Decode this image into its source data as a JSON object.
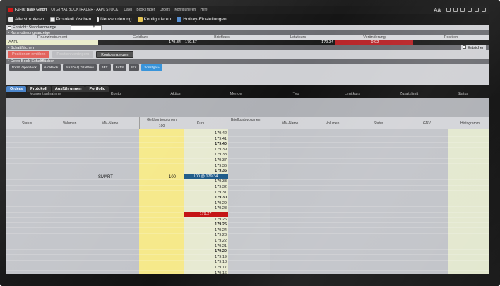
{
  "app": {
    "name": "FXFlat Bank GmbH",
    "window_title": "UTGTHA1 BOOKTRADER - AAPL STOCK",
    "menu": [
      "Datei",
      "BookTrader",
      "Orders",
      "Konfigurieren",
      "Hilfe"
    ],
    "font_label": "Aa"
  },
  "toolbar": {
    "cancel_all": "Alle stornieren",
    "clear_log": "Protokoll löschen",
    "recenter": "Neuzentrierung",
    "configure": "Konfigurieren",
    "hotkey": "Hotkey-Einstellungen"
  },
  "entsicht": {
    "label": "Entsicht: Standardmenge",
    "qty": "5"
  },
  "kurs": {
    "section": "Kursnotierungsanzeige",
    "headers": [
      "Finanzinstrument",
      "Geldkurs",
      "Briefkurs",
      "Letztkurs",
      "Veränderung",
      "Position"
    ],
    "row": {
      "symbol": "AAPL",
      "bid": "- 179.34",
      "ask": "179.57 -",
      "last": "179.34",
      "change": "-0.92",
      "position": ""
    }
  },
  "schalt": {
    "section": "Schaltflächen",
    "checkbox_label": "Entsicherl",
    "buy": "Positionen erhöhen",
    "sell": "Position verringern",
    "account": "Konto anzeigen"
  },
  "deep": {
    "section": "Deep-Book-Schaltflächen",
    "buttons": [
      "NYSE OpenBook",
      "ArcaBook",
      "NASDAQ TotalView",
      "BEX",
      "BATS",
      "IEX",
      "Sonstige »"
    ]
  },
  "tabs": [
    "Orders",
    "Protokoll",
    "Ausführungen",
    "Portfolio"
  ],
  "orders_headers": [
    "Momentaufnahme",
    "Konto",
    "Aktion",
    "Menge",
    "Typ",
    "Limitkurs",
    "Zusatzlimit",
    "Status"
  ],
  "book_headers": {
    "left": [
      "Status",
      "Volumen",
      "MM-Name"
    ],
    "geld_top": "Geldkontovolumen",
    "geld_bottom": "100",
    "kurs": "Kurs",
    "brief_top": "Briefkontovolumen",
    "right": [
      "MM-Name",
      "Volumen",
      "Status",
      "GNV",
      "Histogramm"
    ]
  },
  "book": {
    "smart_label": "SMART",
    "bid_size": "100",
    "prices": [
      "179.42",
      "179.41",
      "179.40",
      "179.39",
      "179.38",
      "179.37",
      "179.36",
      "179.35",
      "179.34",
      "179.33",
      "179.32",
      "179.31",
      "179.30",
      "179.29",
      "179.28",
      "179.27",
      "179.26",
      "179.25",
      "179.24",
      "179.23",
      "179.22",
      "179.21",
      "179.20",
      "179.19",
      "179.18",
      "179.17",
      "179.16"
    ],
    "bold": [
      "179.40",
      "179.35",
      "179.30",
      "179.25",
      "179.20"
    ],
    "highlight_bid": "100 @ 179.34",
    "highlight_red": "179.27"
  },
  "colors": {
    "accent": "#2f8fd8",
    "bid_col": "#f6e98a",
    "hist_col": "#e3e8cf",
    "red": "#c41414",
    "blue_hl": "#1f5c8a"
  }
}
